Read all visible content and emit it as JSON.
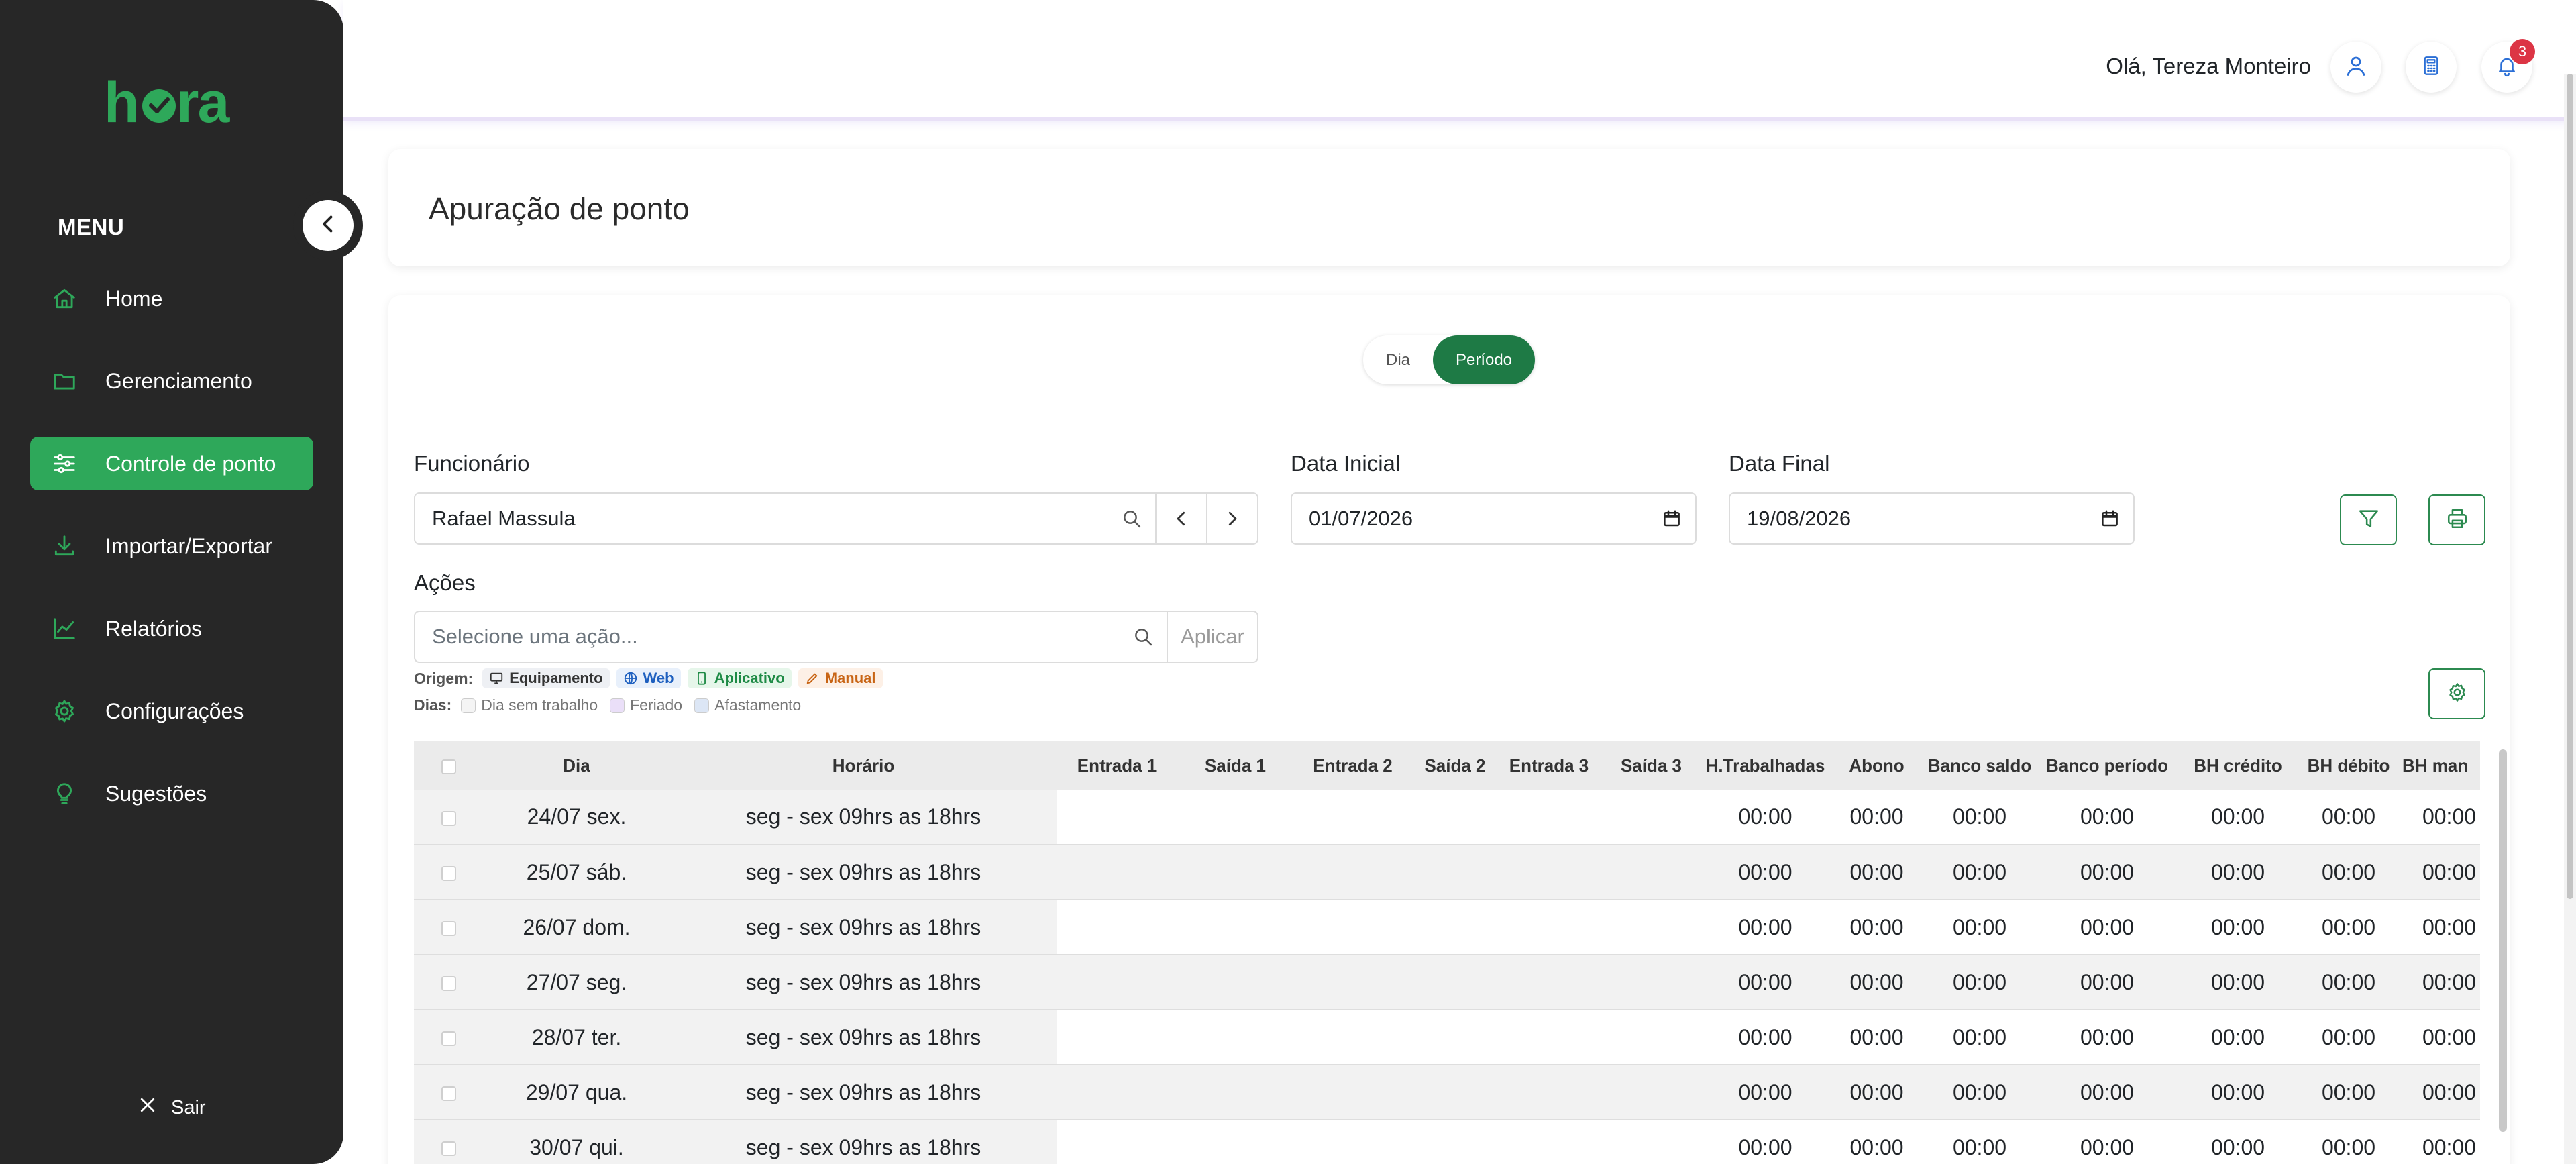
{
  "app": {
    "brand": "hora",
    "brand_color": "#2ea85a"
  },
  "sidebar": {
    "menu_title": "MENU",
    "items": [
      {
        "label": "Home",
        "icon": "home-icon",
        "active": false
      },
      {
        "label": "Gerenciamento",
        "icon": "folder-icon",
        "active": false
      },
      {
        "label": "Controle de ponto",
        "icon": "sliders-icon",
        "active": true
      },
      {
        "label": "Importar/Exportar",
        "icon": "download-icon",
        "active": false
      },
      {
        "label": "Relatórios",
        "icon": "chart-icon",
        "active": false
      },
      {
        "label": "Configurações",
        "icon": "gear-icon",
        "active": false
      },
      {
        "label": "Sugestões",
        "icon": "lightbulb-icon",
        "active": false
      }
    ],
    "logout_label": "Sair"
  },
  "header": {
    "greeting": "Olá, Tereza Monteiro",
    "notification_count": "3"
  },
  "page": {
    "title": "Apuração de ponto"
  },
  "view_toggle": {
    "options": [
      "Dia",
      "Período"
    ],
    "selected": "Período"
  },
  "filters": {
    "employee_label": "Funcionário",
    "employee_value": "Rafael Massula",
    "start_label": "Data Inicial",
    "start_value": "01/07/2026",
    "end_label": "Data Final",
    "end_value": "19/08/2026",
    "actions_label": "Ações",
    "actions_placeholder": "Selecione uma ação...",
    "apply_label": "Aplicar"
  },
  "legend": {
    "origin_label": "Origem:",
    "origins": [
      "Equipamento",
      "Web",
      "Aplicativo",
      "Manual"
    ],
    "days_label": "Dias:",
    "days": [
      "Dia sem trabalho",
      "Feriado",
      "Afastamento"
    ]
  },
  "table": {
    "columns": [
      "Dia",
      "Horário",
      "Entrada 1",
      "Saída 1",
      "Entrada 2",
      "Saída 2",
      "Entrada 3",
      "Saída 3",
      "H.Trabalhadas",
      "Abono",
      "Banco saldo",
      "Banco período",
      "BH crédito",
      "BH débito",
      "BH man"
    ],
    "rows": [
      {
        "dia": "24/07 sex.",
        "horario": "seg - sex 09hrs as 18hrs",
        "values": [
          "00:00",
          "00:00",
          "00:00",
          "00:00",
          "00:00",
          "00:00",
          "00:00"
        ]
      },
      {
        "dia": "25/07 sáb.",
        "horario": "seg - sex 09hrs as 18hrs",
        "values": [
          "00:00",
          "00:00",
          "00:00",
          "00:00",
          "00:00",
          "00:00",
          "00:00"
        ]
      },
      {
        "dia": "26/07 dom.",
        "horario": "seg - sex 09hrs as 18hrs",
        "values": [
          "00:00",
          "00:00",
          "00:00",
          "00:00",
          "00:00",
          "00:00",
          "00:00"
        ]
      },
      {
        "dia": "27/07 seg.",
        "horario": "seg - sex 09hrs as 18hrs",
        "values": [
          "00:00",
          "00:00",
          "00:00",
          "00:00",
          "00:00",
          "00:00",
          "00:00"
        ]
      },
      {
        "dia": "28/07 ter.",
        "horario": "seg - sex 09hrs as 18hrs",
        "values": [
          "00:00",
          "00:00",
          "00:00",
          "00:00",
          "00:00",
          "00:00",
          "00:00"
        ]
      },
      {
        "dia": "29/07 qua.",
        "horario": "seg - sex 09hrs as 18hrs",
        "values": [
          "00:00",
          "00:00",
          "00:00",
          "00:00",
          "00:00",
          "00:00",
          "00:00"
        ]
      },
      {
        "dia": "30/07 qui.",
        "horario": "seg - sex 09hrs as 18hrs",
        "values": [
          "00:00",
          "00:00",
          "00:00",
          "00:00",
          "00:00",
          "00:00",
          "00:00"
        ]
      }
    ]
  }
}
